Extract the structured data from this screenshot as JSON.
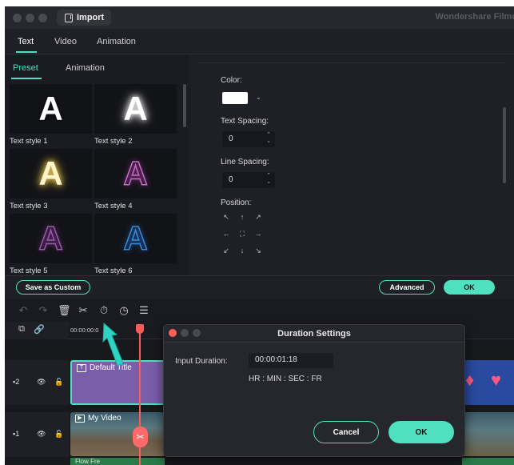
{
  "titlebar": {
    "import_label": "Import",
    "brand": "Wondershare Filmo"
  },
  "tabs": [
    {
      "label": "Text"
    },
    {
      "label": "Video"
    },
    {
      "label": "Animation"
    }
  ],
  "subtabs": [
    {
      "label": "Preset"
    },
    {
      "label": "Animation"
    }
  ],
  "styles": [
    {
      "glyph": "A",
      "label": "Text style 1"
    },
    {
      "glyph": "A",
      "label": "Text style 2"
    },
    {
      "glyph": "A",
      "label": "Text style 3"
    },
    {
      "glyph": "A",
      "label": "Text style 4"
    },
    {
      "glyph": "A",
      "label": "Text style 5"
    },
    {
      "glyph": "A",
      "label": "Text style 6"
    }
  ],
  "props": {
    "color_label": "Color:",
    "color_value": "#ffffff",
    "text_spacing_label": "Text Spacing:",
    "text_spacing_value": "0",
    "line_spacing_label": "Line Spacing:",
    "line_spacing_value": "0",
    "position_label": "Position:",
    "position_arrows": [
      "↖",
      "↑",
      "↗",
      "←",
      "⛶",
      "→",
      "↙",
      "↓",
      "↘"
    ]
  },
  "actions": {
    "save_custom": "Save as Custom",
    "advanced": "Advanced",
    "ok": "OK"
  },
  "toolbar": {
    "icons": [
      "undo-icon",
      "redo-icon",
      "delete-icon",
      "cut-icon",
      "duration-icon",
      "speed-icon",
      "adjust-icon"
    ]
  },
  "timeline": {
    "timecode": "00:00:00:0",
    "tracks": [
      {
        "number": "2",
        "clip": "Default Title"
      },
      {
        "number": "1",
        "clip": "My Video"
      }
    ],
    "audio_clip": "Flow Fre"
  },
  "dialog": {
    "title": "Duration Settings",
    "input_label": "Input Duration:",
    "input_value": "00:00:01:18",
    "format_hint": "HR : MIN : SEC : FR",
    "cancel": "Cancel",
    "ok": "OK"
  },
  "colors": {
    "accent": "#4fe0c0",
    "playhead": "#ff5a5a",
    "title_clip": "#7a5ea8"
  }
}
